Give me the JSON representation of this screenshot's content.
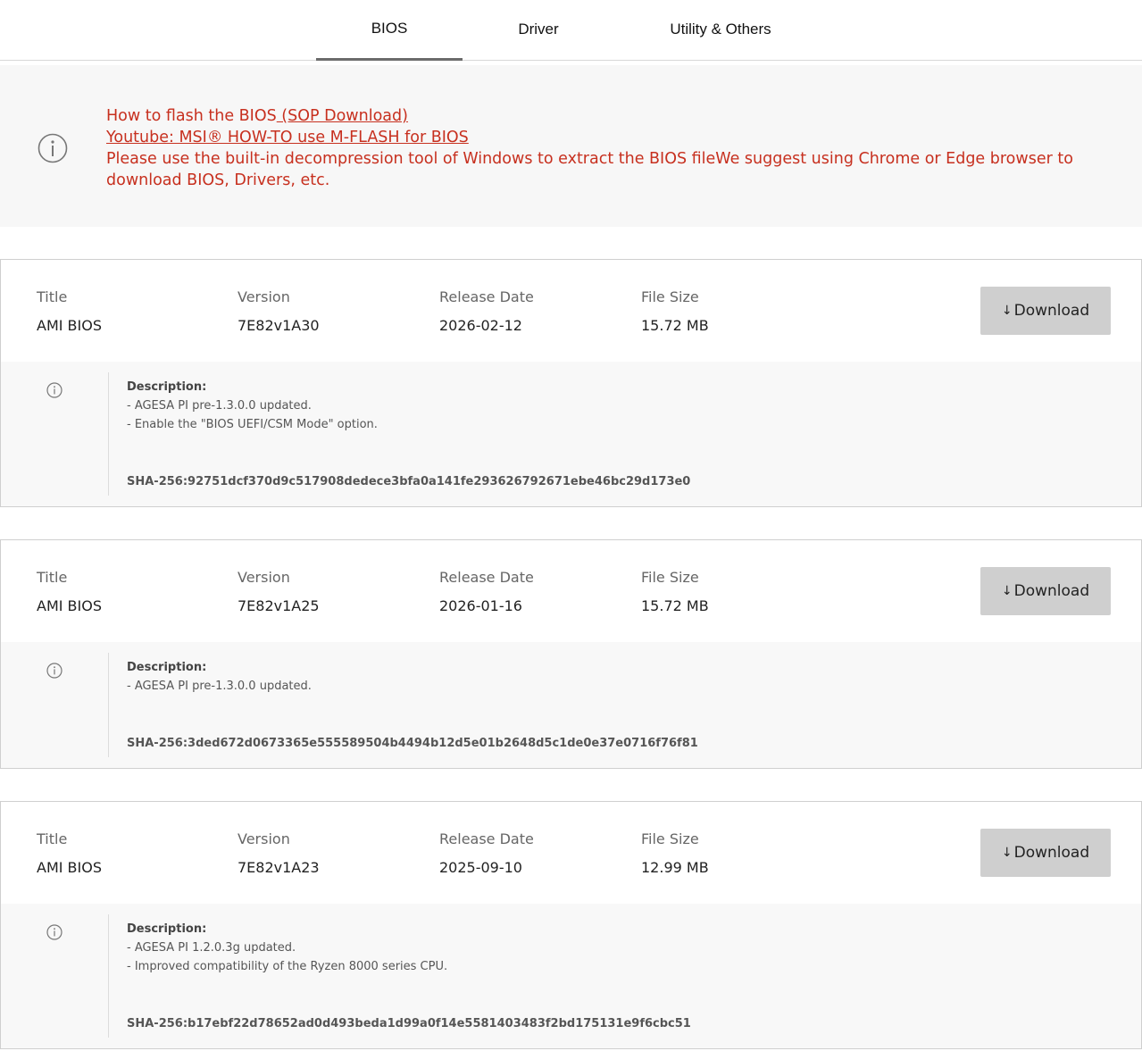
{
  "tabs": [
    {
      "label": "BIOS",
      "active": true
    },
    {
      "label": "Driver",
      "active": false
    },
    {
      "label": "Utility & Others",
      "active": false
    }
  ],
  "notice": {
    "icon": "info-icon",
    "line1_text": "How to flash the BIOS",
    "line1_link": " (SOP Download)",
    "line2_link": "Youtube: MSI® HOW-TO use M-FLASH for BIOS",
    "line3_text": "Please use the built-in decompression tool of Windows to extract the BIOS fileWe suggest using Chrome or Edge browser to download BIOS, Drivers, etc.",
    "color": "#c7301f"
  },
  "labels": {
    "title": "Title",
    "version": "Version",
    "release_date": "Release Date",
    "file_size": "File Size",
    "download": "Download",
    "description": "Description:"
  },
  "files": [
    {
      "title": "AMI BIOS",
      "version": "7E82v1A30",
      "release_date": "2026-02-12",
      "file_size": "15.72 MB",
      "desc": [
        "- AGESA PI pre-1.3.0.0 updated.",
        "- Enable the \"BIOS UEFI/CSM Mode\" option."
      ],
      "sha": "SHA-256:92751dcf370d9c517908dedece3bfa0a141fe293626792671ebe46bc29d173e0"
    },
    {
      "title": "AMI BIOS",
      "version": "7E82v1A25",
      "release_date": "2026-01-16",
      "file_size": "15.72 MB",
      "desc": [
        "- AGESA PI pre-1.3.0.0 updated."
      ],
      "sha": "SHA-256:3ded672d0673365e555589504b4494b12d5e01b2648d5c1de0e37e0716f76f81"
    },
    {
      "title": "AMI BIOS",
      "version": "7E82v1A23",
      "release_date": "2025-09-10",
      "file_size": "12.99 MB",
      "desc": [
        "- AGESA PI 1.2.0.3g updated.",
        "- Improved compatibility of the Ryzen 8000 series CPU."
      ],
      "sha": "SHA-256:b17ebf22d78652ad0d493beda1d99a0f14e5581403483f2bd175131e9f6cbc51"
    }
  ]
}
